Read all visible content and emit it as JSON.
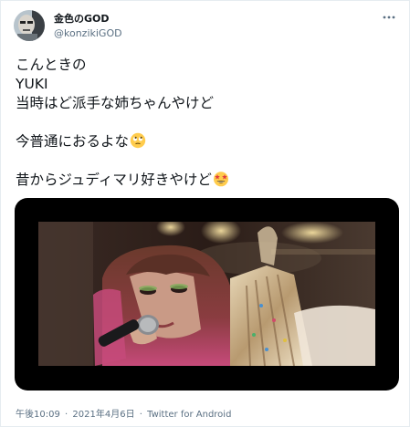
{
  "author": {
    "name": "金色のGOD",
    "handle": "@konzikiGOD",
    "avatar_icon": "avatar-image"
  },
  "more_icon": "more-dots-icon",
  "tweet": {
    "lines": [
      "こんときの",
      "YUKI",
      "当時はど派手な姉ちゃんやけど",
      "",
      "今普通におるよな",
      "",
      "昔からジュディマリ好きやけど"
    ],
    "emoji_1": "face-with-rolling-eyes-emoji",
    "emoji_2": "star-struck-emoji"
  },
  "media": {
    "kind": "video-frame",
    "description_icon": "concert-still-image"
  },
  "meta": {
    "time": "午後10:09",
    "separator": "·",
    "date": "2021年4月6日",
    "source": "Twitter for Android"
  },
  "colors": {
    "text": "#0f1419",
    "secondary": "#5b7083",
    "border": "#e6ecf0"
  }
}
